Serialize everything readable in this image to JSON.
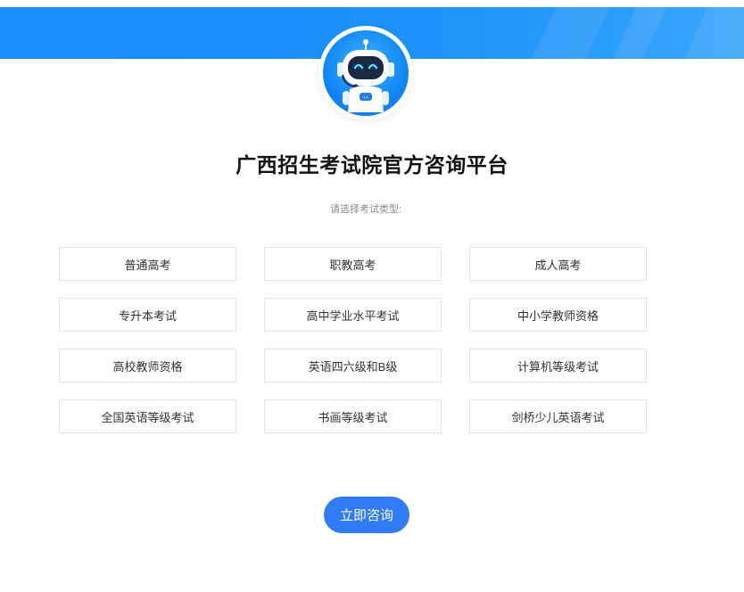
{
  "header": {
    "title": "广西招生考试院官方咨询平台",
    "prompt": "请选择考试类型:",
    "avatar_icon": "robot-icon",
    "banner_color": "#1a8dff"
  },
  "options": [
    "普通高考",
    "职教高考",
    "成人高考",
    "专升本考试",
    "高中学业水平考试",
    "中小学教师资格",
    "高校教师资格",
    "英语四六级和B级",
    "计算机等级考试",
    "全国英语等级考试",
    "书画等级考试",
    "剑桥少儿英语考试"
  ],
  "actions": {
    "consult_label": "立即咨询",
    "button_color": "#2f7cf6"
  }
}
